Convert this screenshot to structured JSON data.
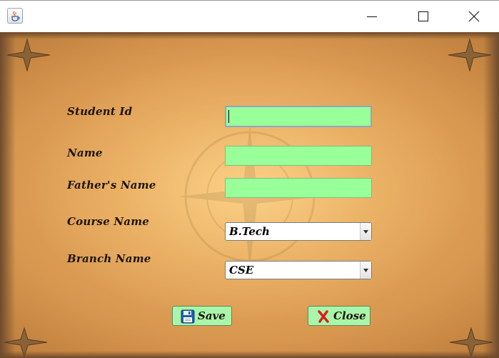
{
  "window": {
    "icons": {
      "app": "java-cup-icon",
      "minimize": "minimize-icon",
      "maximize": "maximize-icon",
      "close": "close-icon"
    }
  },
  "form": {
    "student_id": {
      "label": "Student Id",
      "value": ""
    },
    "name": {
      "label": "Name",
      "value": ""
    },
    "fathers_name": {
      "label": "Father's Name",
      "value": ""
    },
    "course": {
      "label": "Course Name",
      "selected": "B.Tech"
    },
    "branch": {
      "label": "Branch Name",
      "selected": "CSE"
    }
  },
  "buttons": {
    "save": {
      "label": "Save",
      "icon": "floppy-disk-icon"
    },
    "close": {
      "label": "Close",
      "icon": "red-x-icon"
    }
  },
  "colors": {
    "field_bg": "#99ff99",
    "button_bg": "#a9f5a9",
    "parchment": "#e7ad68"
  }
}
